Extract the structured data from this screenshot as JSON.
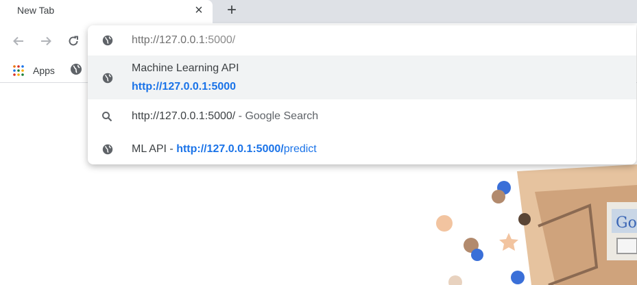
{
  "tab": {
    "title": "New Tab",
    "close_label": "×",
    "new_tab_label": "+"
  },
  "toolbar": {
    "back_icon": "arrow-back-icon",
    "forward_icon": "arrow-forward-icon",
    "reload_icon": "reload-icon"
  },
  "bookmarks": {
    "apps_label": "Apps"
  },
  "omnibox": {
    "input": {
      "host": "http://127.0.0.1:",
      "path": "5000/"
    },
    "suggestions": [
      {
        "icon": "globe-icon",
        "title": "Machine Learning API",
        "url": "http://127.0.0.1:5000"
      },
      {
        "icon": "search-icon",
        "query": "http://127.0.0.1:5000/",
        "suffix": " - Google Search"
      },
      {
        "icon": "globe-icon",
        "title": "ML API",
        "separator": " - ",
        "url_host": "http://127.0.0.1:5000/",
        "url_path": "predict"
      }
    ]
  },
  "colors": {
    "link_blue": "#1a73e8",
    "tabstrip": "#dee1e6",
    "highlight": "#f1f3f4"
  }
}
